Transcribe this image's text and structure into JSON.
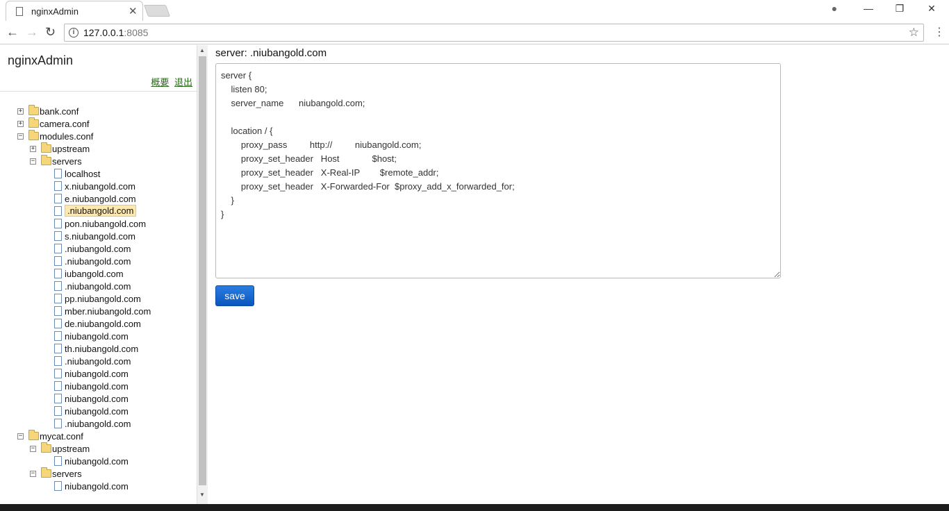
{
  "browser": {
    "tab_title": "nginxAdmin",
    "tab_close": "✕",
    "url_host": "127.0.0.1",
    "url_port": ":8085",
    "controls": {
      "account": "●",
      "minimize": "—",
      "restore": "❐",
      "close": "✕"
    }
  },
  "sidebar": {
    "title": "nginxAdmin",
    "links": [
      "概要",
      "退出"
    ],
    "tree": [
      {
        "label": "bank.conf",
        "type": "folder",
        "toggle": "+",
        "depth": 0
      },
      {
        "label": "camera.conf",
        "type": "folder",
        "toggle": "+",
        "depth": 0
      },
      {
        "label": "modules.conf",
        "type": "folder",
        "toggle": "−",
        "depth": 0
      },
      {
        "label": "upstream",
        "type": "folder",
        "toggle": "+",
        "depth": 1
      },
      {
        "label": "servers",
        "type": "folder",
        "toggle": "−",
        "depth": 1
      },
      {
        "label": "localhost",
        "type": "file",
        "depth": 2
      },
      {
        "label": "x.niubangold.com",
        "type": "file",
        "depth": 2
      },
      {
        "label": "e.niubangold.com",
        "type": "file",
        "depth": 2
      },
      {
        "label": ".niubangold.com",
        "type": "file",
        "depth": 2,
        "selected": true
      },
      {
        "label": "pon.niubangold.com",
        "type": "file",
        "depth": 2
      },
      {
        "label": "s.niubangold.com",
        "type": "file",
        "depth": 2
      },
      {
        "label": ".niubangold.com",
        "type": "file",
        "depth": 2
      },
      {
        "label": ".niubangold.com",
        "type": "file",
        "depth": 2
      },
      {
        "label": "iubangold.com",
        "type": "file",
        "depth": 2
      },
      {
        "label": ".niubangold.com",
        "type": "file",
        "depth": 2
      },
      {
        "label": "pp.niubangold.com",
        "type": "file",
        "depth": 2
      },
      {
        "label": "mber.niubangold.com",
        "type": "file",
        "depth": 2
      },
      {
        "label": "de.niubangold.com",
        "type": "file",
        "depth": 2
      },
      {
        "label": "niubangold.com",
        "type": "file",
        "depth": 2
      },
      {
        "label": "th.niubangold.com",
        "type": "file",
        "depth": 2
      },
      {
        "label": ".niubangold.com",
        "type": "file",
        "depth": 2
      },
      {
        "label": "niubangold.com",
        "type": "file",
        "depth": 2
      },
      {
        "label": "niubangold.com",
        "type": "file",
        "depth": 2
      },
      {
        "label": "niubangold.com",
        "type": "file",
        "depth": 2
      },
      {
        "label": "niubangold.com",
        "type": "file",
        "depth": 2
      },
      {
        "label": ".niubangold.com",
        "type": "file",
        "depth": 2
      },
      {
        "label": "mycat.conf",
        "type": "folder",
        "toggle": "−",
        "depth": 0
      },
      {
        "label": "upstream",
        "type": "folder",
        "toggle": "−",
        "depth": 1
      },
      {
        "label": "niubangold.com",
        "type": "file",
        "depth": 2
      },
      {
        "label": "servers",
        "type": "folder",
        "toggle": "−",
        "depth": 1
      },
      {
        "label": "niubangold.com",
        "type": "file",
        "depth": 2
      }
    ]
  },
  "main": {
    "server_title": "server:     .niubangold.com",
    "config": "server {\n    listen 80;\n    server_name      niubangold.com;\n\n    location / {\n        proxy_pass         http://         niubangold.com;\n        proxy_set_header   Host             $host;\n        proxy_set_header   X-Real-IP        $remote_addr;\n        proxy_set_header   X-Forwarded-For  $proxy_add_x_forwarded_for;\n    }\n}",
    "save_label": "save"
  }
}
